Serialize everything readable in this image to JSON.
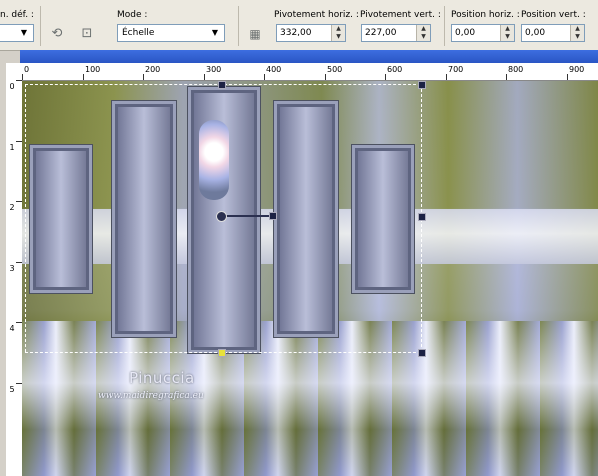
{
  "toolbar": {
    "preset_label": "n. déf. :",
    "mode_label": "Mode :",
    "mode_value": "Échelle",
    "pivot_h_label": "Pivotement horiz. :",
    "pivot_h_value": "332,00",
    "pivot_v_label": "Pivotement vert. :",
    "pivot_v_value": "227,00",
    "pos_h_label": "Position horiz. :",
    "pos_h_value": "0,00",
    "pos_v_label": "Position vert. :",
    "pos_v_value": "0,00"
  },
  "ruler": {
    "top_labels": [
      "0",
      "100",
      "200",
      "300",
      "400",
      "500",
      "600",
      "700",
      "800",
      "900"
    ],
    "left_labels": [
      "0",
      "1",
      "2",
      "3",
      "4",
      "5"
    ]
  },
  "watermark": {
    "name": "Pinuccia",
    "url": "www.maidiregrafica.eu"
  },
  "icons": [
    "dropdown-arrow-icon",
    "pick-tool-icon",
    "reset-icon",
    "spin-up-icon",
    "spin-down-icon"
  ]
}
